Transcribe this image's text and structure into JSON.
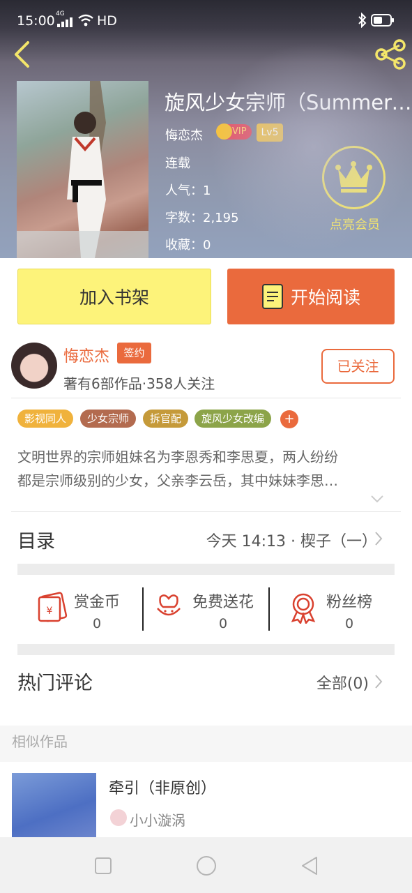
{
  "status_bar": {
    "time": "15:00",
    "network": "4G",
    "hd": "HD"
  },
  "book": {
    "title": "旋风少女宗师（Summerdream",
    "author": "悔恋杰",
    "vip_label": "VIP",
    "level": "Lv5",
    "status": "连载",
    "popularity": "人气：1",
    "word_count": "字数：2,195",
    "favorites": "收藏：0"
  },
  "member": {
    "label": "点亮会员"
  },
  "actions": {
    "add_shelf": "加入书架",
    "start_reading": "开始阅读"
  },
  "author_card": {
    "name": "悔恋杰",
    "badge": "签约",
    "summary": "著有6部作品·358人关注",
    "follow": "已关注"
  },
  "tags": [
    {
      "label": "影视同人",
      "color": "#f0b23c"
    },
    {
      "label": "少女宗师",
      "color": "#b36b4f"
    },
    {
      "label": "拆官配",
      "color": "#c59a3a"
    },
    {
      "label": "旋风少女改编",
      "color": "#8ca449"
    }
  ],
  "tag_more": "+",
  "description": {
    "line1": "文明世界的宗师姐妹名为李恩秀和李思夏，两人纷纷",
    "line2": "都是宗师级别的少女，父亲李云岳，其中妹妹李思…"
  },
  "catalog": {
    "label": "目录",
    "latest": "今天 14:13 · 楔子（一）"
  },
  "stats": [
    {
      "label": "赏金币",
      "value": "0",
      "icon": "red-envelope-icon"
    },
    {
      "label": "免费送花",
      "value": "0",
      "icon": "flower-icon"
    },
    {
      "label": "粉丝榜",
      "value": "0",
      "icon": "medal-icon"
    }
  ],
  "comments": {
    "label": "热门评论",
    "all": "全部(0)"
  },
  "similar": {
    "label": "相似作品",
    "items": [
      {
        "title": "牵引（非原创）",
        "author": "小小漩涡"
      }
    ]
  },
  "colors": {
    "accent": "#ea6a3d",
    "shelf": "#fdf37a",
    "member": "#f4e66a"
  }
}
